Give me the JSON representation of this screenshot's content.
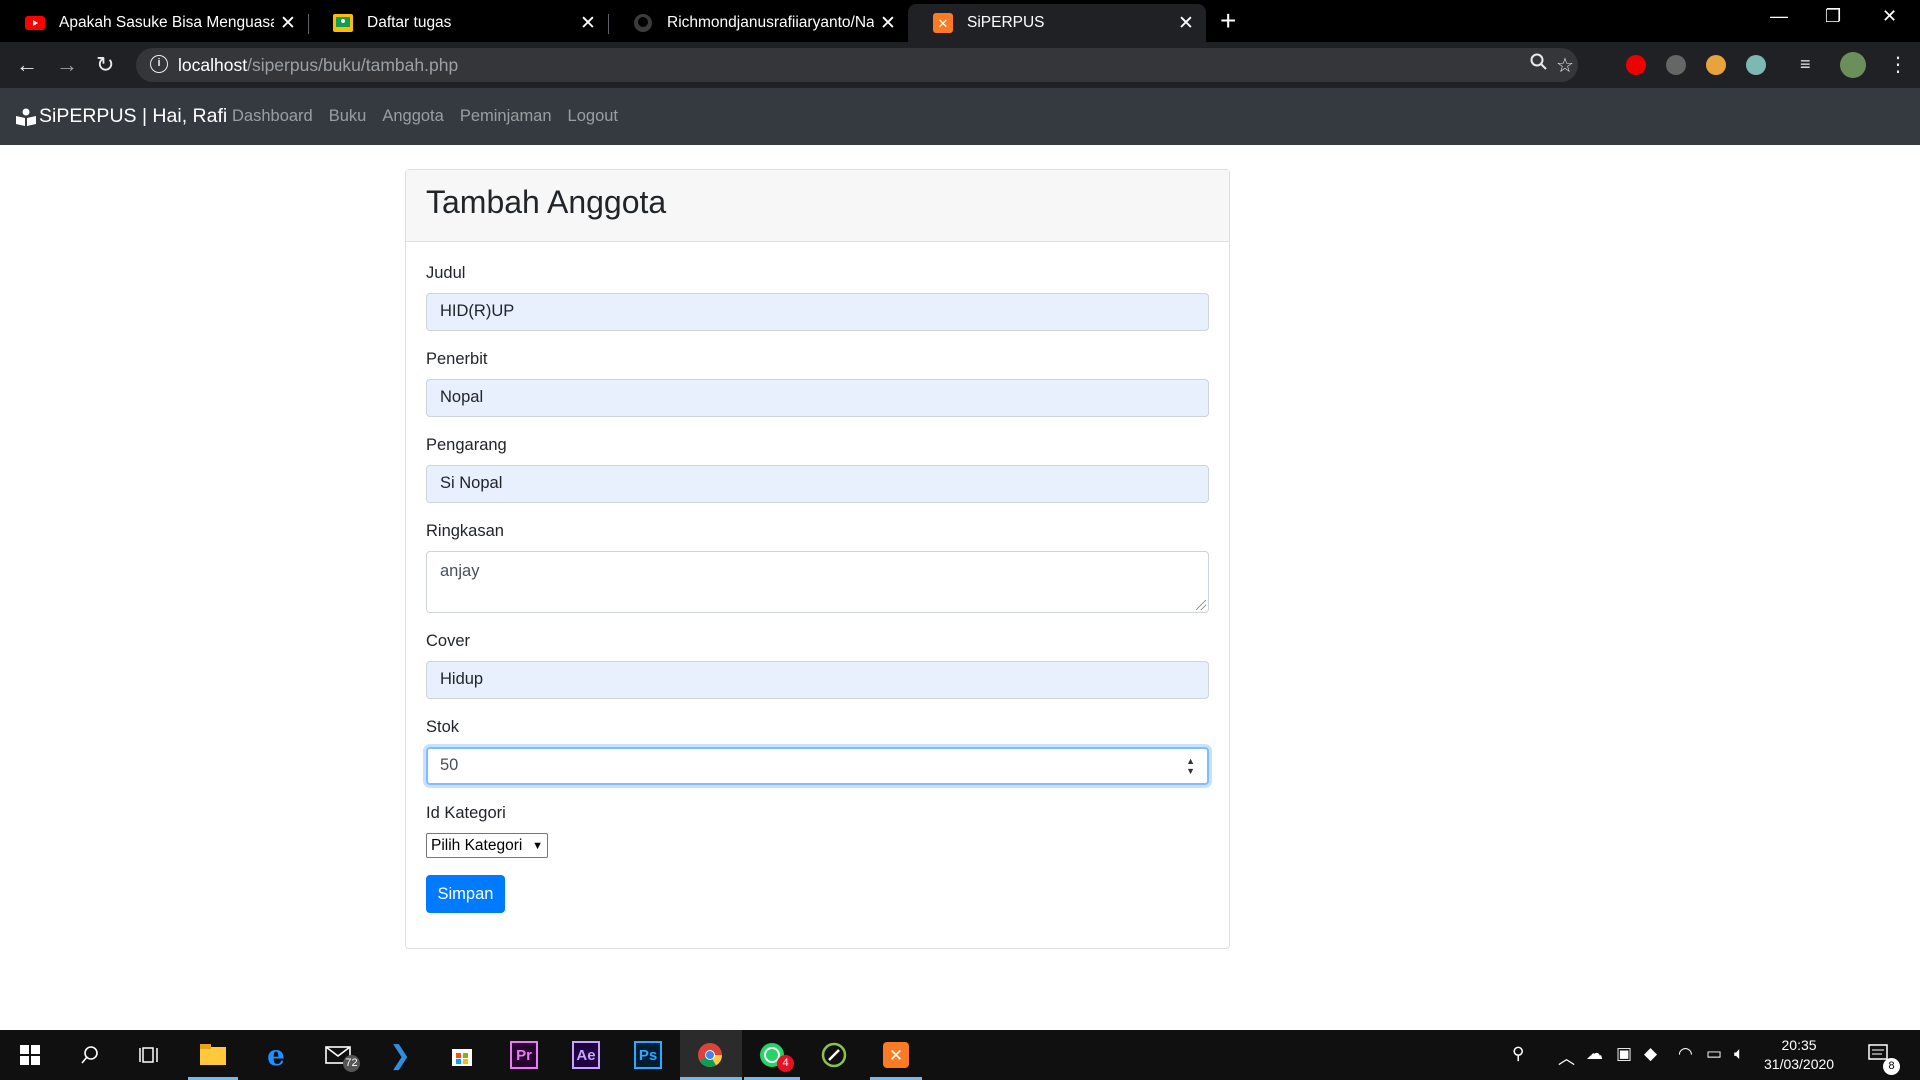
{
  "browser": {
    "tabs": [
      {
        "title": "Apakah Sasuke Bisa Menguasai S",
        "favicon": "youtube-icon"
      },
      {
        "title": "Daftar tugas",
        "favicon": "classroom-icon"
      },
      {
        "title": "Richmondjanusrafiiaryanto/Nativ",
        "favicon": "github-icon"
      },
      {
        "title": "SiPERPUS",
        "favicon": "xampp-icon"
      }
    ],
    "url_host": "localhost",
    "url_path": "/siperpus/buku/tambah.php"
  },
  "navbar": {
    "brand": "SiPERPUS | Hai, Rafi",
    "links": [
      "Dashboard",
      "Buku",
      "Anggota",
      "Peminjaman",
      "Logout"
    ]
  },
  "form": {
    "heading": "Tambah Anggota",
    "judul_label": "Judul",
    "judul_value": "HID(R)UP",
    "penerbit_label": "Penerbit",
    "penerbit_value": "Nopal",
    "pengarang_label": "Pengarang",
    "pengarang_value": "Si Nopal",
    "ringkasan_label": "Ringkasan",
    "ringkasan_value": "anjay",
    "cover_label": "Cover",
    "cover_value": "Hidup",
    "stok_label": "Stok",
    "stok_value": "50",
    "kategori_label": "Id Kategori",
    "kategori_selected": "Pilih Kategori",
    "submit_label": "Simpan"
  },
  "taskbar": {
    "mail_badge": "72",
    "whatsapp_badge": "4",
    "time": "20:35",
    "date": "31/03/2020",
    "notification_count": "8"
  },
  "colors": {
    "primary": "#007bff",
    "navbar_bg": "#343a40",
    "autofill_bg": "#e8f0fe"
  }
}
